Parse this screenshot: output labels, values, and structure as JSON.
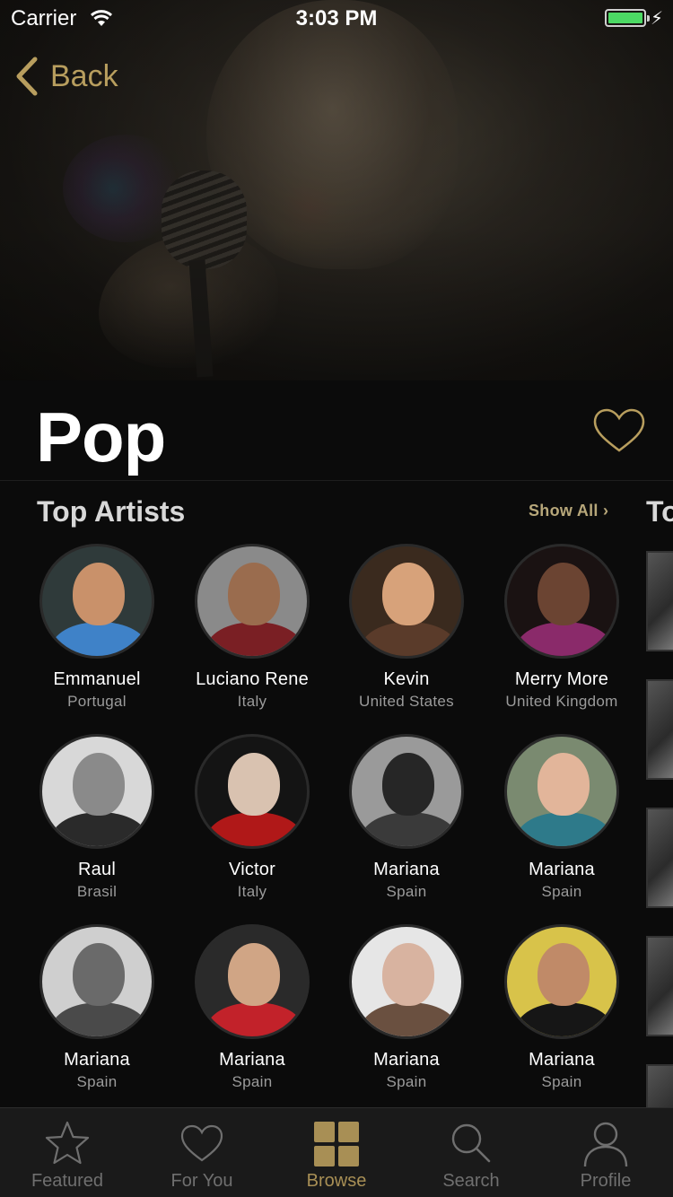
{
  "status_bar": {
    "carrier": "Carrier",
    "time": "3:03 PM"
  },
  "nav": {
    "back_label": "Back"
  },
  "header": {
    "title": "Pop"
  },
  "section": {
    "title": "Top Artists",
    "show_all": "Show All ›",
    "next_section_title": "To"
  },
  "artists": [
    {
      "name": "Emmanuel",
      "country": "Portugal",
      "bg": "#2f3a3a",
      "skin": "#c9916a",
      "shirt": "#3f82c8"
    },
    {
      "name": "Luciano Rene",
      "country": "Italy",
      "bg": "#8a8a8a",
      "skin": "#9a6c4e",
      "shirt": "#7a1f24"
    },
    {
      "name": "Kevin",
      "country": "United States",
      "bg": "#3a2a1e",
      "skin": "#d7a27a",
      "shirt": "#5a3b2a"
    },
    {
      "name": "Merry More",
      "country": "United Kingdom",
      "bg": "#1a1212",
      "skin": "#6b4432",
      "shirt": "#8a2a6a"
    },
    {
      "name": "Raul",
      "country": "Brasil",
      "bg": "#d8d8d8",
      "skin": "#8a8a8a",
      "shirt": "#2a2a2a"
    },
    {
      "name": "Victor",
      "country": "Italy",
      "bg": "#141414",
      "skin": "#d9c2b0",
      "shirt": "#b01818"
    },
    {
      "name": "Mariana",
      "country": "Spain",
      "bg": "#9a9a9a",
      "skin": "#262626",
      "shirt": "#3a3a3a"
    },
    {
      "name": "Mariana",
      "country": "Spain",
      "bg": "#7a8a70",
      "skin": "#e2b59a",
      "shirt": "#2e7a8a"
    },
    {
      "name": "Mariana",
      "country": "Spain",
      "bg": "#cfcfcf",
      "skin": "#6a6a6a",
      "shirt": "#4a4a4a"
    },
    {
      "name": "Mariana",
      "country": "Spain",
      "bg": "#2a2a2a",
      "skin": "#d0a585",
      "shirt": "#c2222a"
    },
    {
      "name": "Mariana",
      "country": "Spain",
      "bg": "#e6e6e6",
      "skin": "#d8b3a0",
      "shirt": "#6a5040"
    },
    {
      "name": "Mariana",
      "country": "Spain",
      "bg": "#d8c34a",
      "skin": "#c08a68",
      "shirt": "#161616"
    }
  ],
  "tabs": [
    {
      "label": "Featured",
      "icon": "star-icon",
      "active": false
    },
    {
      "label": "For You",
      "icon": "heart-icon",
      "active": false
    },
    {
      "label": "Browse",
      "icon": "grid-icon",
      "active": true
    },
    {
      "label": "Search",
      "icon": "search-icon",
      "active": false
    },
    {
      "label": "Profile",
      "icon": "person-icon",
      "active": false
    }
  ],
  "colors": {
    "accent": "#b89e5e",
    "active_tab": "#a88f55",
    "battery": "#4cd964",
    "background": "#0b0b0b"
  }
}
